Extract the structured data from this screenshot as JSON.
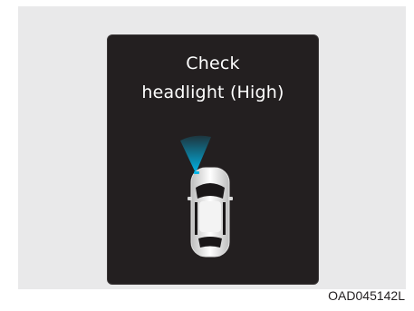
{
  "warning": {
    "line1": "Check",
    "line2": "headlight (High)"
  },
  "icon": {
    "name": "car-headlight-warning-icon",
    "beam_color": "#00b4e6"
  },
  "figure_code": "OAD045142L"
}
